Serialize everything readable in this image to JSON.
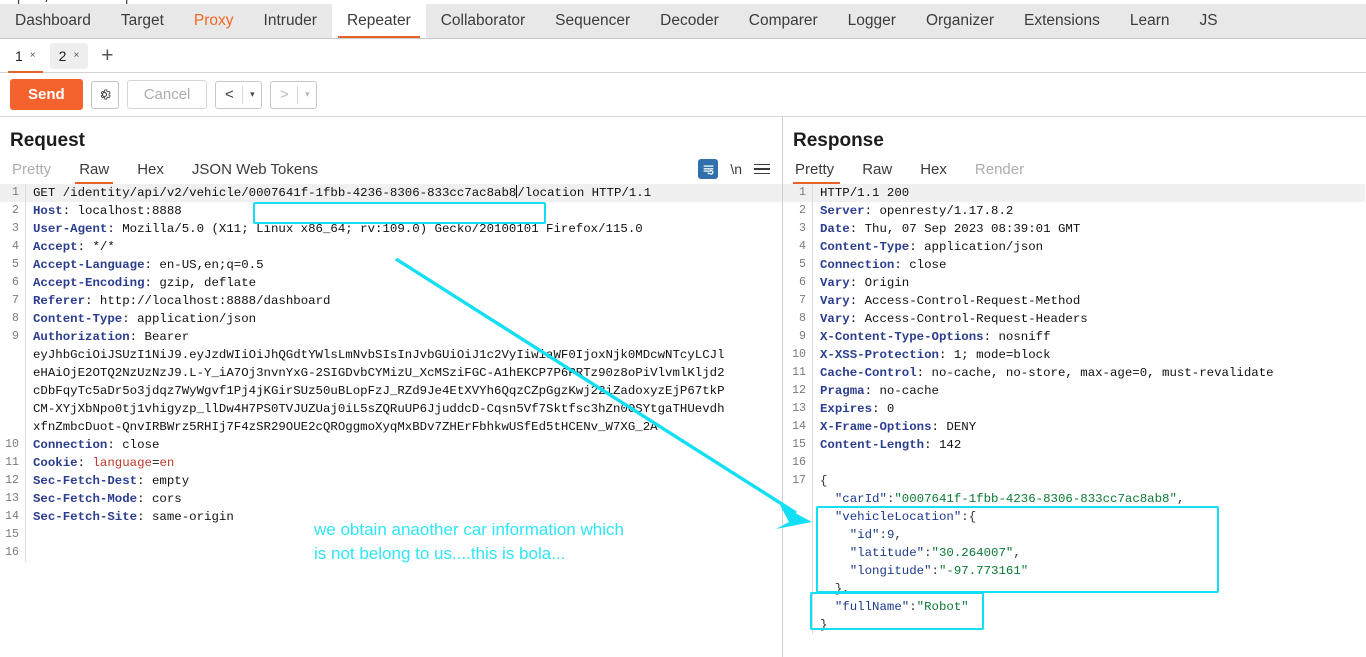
{
  "app": {
    "name": "Burp Suite Repeater",
    "accent_color": "#f4622e",
    "annotation_color": "#2ee6f5"
  },
  "main_nav": {
    "tabs": [
      {
        "label": "Dashboard",
        "state": "normal"
      },
      {
        "label": "Target",
        "state": "normal"
      },
      {
        "label": "Proxy",
        "state": "accent"
      },
      {
        "label": "Intruder",
        "state": "normal"
      },
      {
        "label": "Repeater",
        "state": "active"
      },
      {
        "label": "Collaborator",
        "state": "normal"
      },
      {
        "label": "Sequencer",
        "state": "normal"
      },
      {
        "label": "Decoder",
        "state": "normal"
      },
      {
        "label": "Comparer",
        "state": "normal"
      },
      {
        "label": "Logger",
        "state": "normal"
      },
      {
        "label": "Organizer",
        "state": "normal"
      },
      {
        "label": "Extensions",
        "state": "normal"
      },
      {
        "label": "Learn",
        "state": "normal"
      },
      {
        "label": "JS",
        "state": "normal"
      }
    ]
  },
  "repeater_tabs": {
    "items": [
      {
        "label": "1",
        "close": "×",
        "selected": true
      },
      {
        "label": "2",
        "close": "×",
        "selected": false
      }
    ],
    "add_label": "+"
  },
  "toolbar": {
    "send_label": "Send",
    "settings_icon": "gear-icon",
    "cancel_label": "Cancel",
    "back_label": "<",
    "back_caret": "▾",
    "forward_label": ">",
    "forward_caret": "▾"
  },
  "request": {
    "title": "Request",
    "view_tabs": [
      {
        "label": "Pretty",
        "active": false,
        "disabled": true
      },
      {
        "label": "Raw",
        "active": true,
        "disabled": false
      },
      {
        "label": "Hex",
        "active": false,
        "disabled": false
      },
      {
        "label": "JSON Web Tokens",
        "active": false,
        "disabled": false
      }
    ],
    "tools": {
      "wrap_icon": "word-wrap-icon",
      "newline_label": "\\n",
      "menu_icon": "hamburger-menu-icon"
    },
    "lines": [
      {
        "n": "1",
        "segments": [
          {
            "t": "GET /identity/api/v2/vehicle/",
            "c": "val"
          },
          {
            "t": "0007641f-1fbb-4236-8306-833cc7ac8ab8",
            "c": "val"
          },
          {
            "t": "/location HTTP/1.1",
            "c": "val"
          }
        ]
      },
      {
        "n": "2",
        "segments": [
          {
            "t": "Host",
            "c": "hdr"
          },
          {
            "t": ": localhost:8888",
            "c": "val"
          }
        ]
      },
      {
        "n": "3",
        "segments": [
          {
            "t": "User-Agent",
            "c": "hdr"
          },
          {
            "t": ": Mozilla/5.0 (X11; Linux x86_64; rv:109.0) Gecko/20100101 Firefox/115.0",
            "c": "val"
          }
        ]
      },
      {
        "n": "4",
        "segments": [
          {
            "t": "Accept",
            "c": "hdr"
          },
          {
            "t": ": */*",
            "c": "val"
          }
        ]
      },
      {
        "n": "5",
        "segments": [
          {
            "t": "Accept-Language",
            "c": "hdr"
          },
          {
            "t": ": en-US,en;q=0.5",
            "c": "val"
          }
        ]
      },
      {
        "n": "6",
        "segments": [
          {
            "t": "Accept-Encoding",
            "c": "hdr"
          },
          {
            "t": ": gzip, deflate",
            "c": "val"
          }
        ]
      },
      {
        "n": "7",
        "segments": [
          {
            "t": "Referer",
            "c": "hdr"
          },
          {
            "t": ": http://localhost:8888/dashboard",
            "c": "val"
          }
        ]
      },
      {
        "n": "8",
        "segments": [
          {
            "t": "Content-Type",
            "c": "hdr"
          },
          {
            "t": ": application/json",
            "c": "val"
          }
        ]
      },
      {
        "n": "9",
        "segments": [
          {
            "t": "Authorization",
            "c": "hdr"
          },
          {
            "t": ": Bearer",
            "c": "val"
          }
        ]
      },
      {
        "n": "",
        "segments": [
          {
            "t": "eyJhbGciOiJSUzI1NiJ9.eyJzdWIiOiJhQGdtYWlsLmNvbSIsInJvbGUiOiJ1c2VyIiwiaWF0IjoxNjk0MDcwNTcyLCJl",
            "c": "val"
          }
        ]
      },
      {
        "n": "",
        "segments": [
          {
            "t": "eHAiOjE2OTQ2NzUzNzJ9.L-Y_iA7Oj3nvnYxG-2SIGDvbCYMizU_XcMSziFGC-A1hEKCP7P6PRTz90z8oPiVlvmlKljd2",
            "c": "val"
          }
        ]
      },
      {
        "n": "",
        "segments": [
          {
            "t": "cDbFqyTc5aDr5o3jdqz7WyWgvf1Pj4jKGirSUz50uBLopFzJ_RZd9Je4EtXVYh6QqzCZpGgzKwj22iZadoxyzEjP67tkP",
            "c": "val"
          }
        ]
      },
      {
        "n": "",
        "segments": [
          {
            "t": "CM-XYjXbNpo0tj1vhigyzp_llDw4H7PS0TVJUZUaj0iL5sZQRuUP6JjuddcD-Cqsn5Vf7Sktfsc3hZn0OSYtgaTHUevdh",
            "c": "val"
          }
        ]
      },
      {
        "n": "",
        "segments": [
          {
            "t": "xfnZmbcDuot-QnvIRBWrz5RHIj7F4zSR29OUE2cQROggmoXyqMxBDv7ZHErFbhkwUSfEd5tHCENv_W7XG_2A",
            "c": "val"
          }
        ]
      },
      {
        "n": "10",
        "segments": [
          {
            "t": "Connection",
            "c": "hdr"
          },
          {
            "t": ": close",
            "c": "val"
          }
        ]
      },
      {
        "n": "11",
        "segments": [
          {
            "t": "Cookie",
            "c": "hdr"
          },
          {
            "t": ": ",
            "c": "val"
          },
          {
            "t": "language",
            "c": "ckey"
          },
          {
            "t": "=",
            "c": "val"
          },
          {
            "t": "en",
            "c": "cval"
          }
        ]
      },
      {
        "n": "12",
        "segments": [
          {
            "t": "Sec-Fetch-Dest",
            "c": "hdr"
          },
          {
            "t": ": empty",
            "c": "val"
          }
        ]
      },
      {
        "n": "13",
        "segments": [
          {
            "t": "Sec-Fetch-Mode",
            "c": "hdr"
          },
          {
            "t": ": cors",
            "c": "val"
          }
        ]
      },
      {
        "n": "14",
        "segments": [
          {
            "t": "Sec-Fetch-Site",
            "c": "hdr"
          },
          {
            "t": ": same-origin",
            "c": "val"
          }
        ]
      },
      {
        "n": "15",
        "segments": [
          {
            "t": "",
            "c": "val"
          }
        ]
      },
      {
        "n": "16",
        "segments": [
          {
            "t": "",
            "c": "val"
          }
        ]
      }
    ]
  },
  "response": {
    "title": "Response",
    "view_tabs": [
      {
        "label": "Pretty",
        "active": true,
        "disabled": false
      },
      {
        "label": "Raw",
        "active": false,
        "disabled": false
      },
      {
        "label": "Hex",
        "active": false,
        "disabled": false
      },
      {
        "label": "Render",
        "active": false,
        "disabled": true
      }
    ],
    "lines": [
      {
        "n": "1",
        "segments": [
          {
            "t": "HTTP/1.1 200",
            "c": "val"
          }
        ]
      },
      {
        "n": "2",
        "segments": [
          {
            "t": "Server",
            "c": "hdr"
          },
          {
            "t": ": openresty/1.17.8.2",
            "c": "val"
          }
        ]
      },
      {
        "n": "3",
        "segments": [
          {
            "t": "Date",
            "c": "hdr"
          },
          {
            "t": ": Thu, 07 Sep 2023 08:39:01 GMT",
            "c": "val"
          }
        ]
      },
      {
        "n": "4",
        "segments": [
          {
            "t": "Content-Type",
            "c": "hdr"
          },
          {
            "t": ": application/json",
            "c": "val"
          }
        ]
      },
      {
        "n": "5",
        "segments": [
          {
            "t": "Connection",
            "c": "hdr"
          },
          {
            "t": ": close",
            "c": "val"
          }
        ]
      },
      {
        "n": "6",
        "segments": [
          {
            "t": "Vary",
            "c": "hdr"
          },
          {
            "t": ": Origin",
            "c": "val"
          }
        ]
      },
      {
        "n": "7",
        "segments": [
          {
            "t": "Vary",
            "c": "hdr"
          },
          {
            "t": ": Access-Control-Request-Method",
            "c": "val"
          }
        ]
      },
      {
        "n": "8",
        "segments": [
          {
            "t": "Vary",
            "c": "hdr"
          },
          {
            "t": ": Access-Control-Request-Headers",
            "c": "val"
          }
        ]
      },
      {
        "n": "9",
        "segments": [
          {
            "t": "X-Content-Type-Options",
            "c": "hdr"
          },
          {
            "t": ": nosniff",
            "c": "val"
          }
        ]
      },
      {
        "n": "10",
        "segments": [
          {
            "t": "X-XSS-Protection",
            "c": "hdr"
          },
          {
            "t": ": 1; mode=block",
            "c": "val"
          }
        ]
      },
      {
        "n": "11",
        "segments": [
          {
            "t": "Cache-Control",
            "c": "hdr"
          },
          {
            "t": ": no-cache, no-store, max-age=0, must-revalidate",
            "c": "val"
          }
        ]
      },
      {
        "n": "12",
        "segments": [
          {
            "t": "Pragma",
            "c": "hdr"
          },
          {
            "t": ": no-cache",
            "c": "val"
          }
        ]
      },
      {
        "n": "13",
        "segments": [
          {
            "t": "Expires",
            "c": "hdr"
          },
          {
            "t": ": 0",
            "c": "val"
          }
        ]
      },
      {
        "n": "14",
        "segments": [
          {
            "t": "X-Frame-Options",
            "c": "hdr"
          },
          {
            "t": ": DENY",
            "c": "val"
          }
        ]
      },
      {
        "n": "15",
        "segments": [
          {
            "t": "Content-Length",
            "c": "hdr"
          },
          {
            "t": ": 142",
            "c": "val"
          }
        ]
      },
      {
        "n": "16",
        "segments": [
          {
            "t": "",
            "c": "val"
          }
        ]
      },
      {
        "n": "17",
        "segments": [
          {
            "t": "{",
            "c": "jpunc"
          }
        ]
      },
      {
        "n": "",
        "segments": [
          {
            "t": "  ",
            "c": "jpunc"
          },
          {
            "t": "\"carId\"",
            "c": "jkey"
          },
          {
            "t": ":",
            "c": "jpunc"
          },
          {
            "t": "\"0007641f-1fbb-4236-8306-833cc7ac8ab8\"",
            "c": "jstr"
          },
          {
            "t": ",",
            "c": "jpunc"
          }
        ]
      },
      {
        "n": "",
        "segments": [
          {
            "t": "  ",
            "c": "jpunc"
          },
          {
            "t": "\"vehicleLocation\"",
            "c": "jkey"
          },
          {
            "t": ":{",
            "c": "jpunc"
          }
        ]
      },
      {
        "n": "",
        "segments": [
          {
            "t": "    ",
            "c": "jpunc"
          },
          {
            "t": "\"id\"",
            "c": "jkey"
          },
          {
            "t": ":",
            "c": "jpunc"
          },
          {
            "t": "9",
            "c": "jnum"
          },
          {
            "t": ",",
            "c": "jpunc"
          }
        ]
      },
      {
        "n": "",
        "segments": [
          {
            "t": "    ",
            "c": "jpunc"
          },
          {
            "t": "\"latitude\"",
            "c": "jkey"
          },
          {
            "t": ":",
            "c": "jpunc"
          },
          {
            "t": "\"30.264007\"",
            "c": "jstr"
          },
          {
            "t": ",",
            "c": "jpunc"
          }
        ]
      },
      {
        "n": "",
        "segments": [
          {
            "t": "    ",
            "c": "jpunc"
          },
          {
            "t": "\"longitude\"",
            "c": "jkey"
          },
          {
            "t": ":",
            "c": "jpunc"
          },
          {
            "t": "\"-97.773161\"",
            "c": "jstr"
          }
        ]
      },
      {
        "n": "",
        "segments": [
          {
            "t": "  },",
            "c": "jpunc"
          }
        ]
      },
      {
        "n": "",
        "segments": [
          {
            "t": "  ",
            "c": "jpunc"
          },
          {
            "t": "\"fullName\"",
            "c": "jkey"
          },
          {
            "t": ":",
            "c": "jpunc"
          },
          {
            "t": "\"Robot\"",
            "c": "jstr"
          }
        ]
      },
      {
        "n": "",
        "segments": [
          {
            "t": "}",
            "c": "jpunc"
          }
        ]
      }
    ]
  },
  "annotations": {
    "note_text": "we obtain anaother car information which\nis not belong to us....this is bola...",
    "boxes": [
      {
        "name": "request-uuid-highlight"
      },
      {
        "name": "response-json-highlight"
      },
      {
        "name": "response-fullname-highlight"
      }
    ],
    "arrow": {
      "name": "pointer-arrow"
    }
  }
}
